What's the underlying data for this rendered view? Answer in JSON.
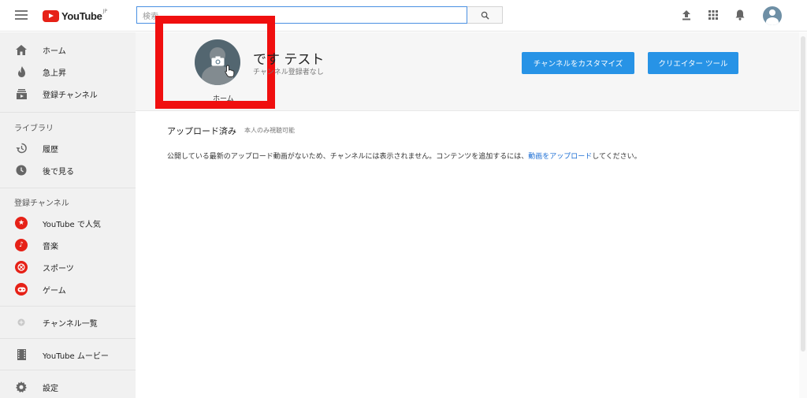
{
  "header": {
    "logo_text": "YouTube",
    "logo_region": "JP",
    "search_placeholder": "検索"
  },
  "sidebar": {
    "primary": [
      {
        "label": "ホーム",
        "icon": "home-icon"
      },
      {
        "label": "急上昇",
        "icon": "flame-icon"
      },
      {
        "label": "登録チャンネル",
        "icon": "subscriptions-icon"
      }
    ],
    "library_heading": "ライブラリ",
    "library": [
      {
        "label": "履歴",
        "icon": "history-icon"
      },
      {
        "label": "後で見る",
        "icon": "clock-icon"
      }
    ],
    "subs_heading": "登録チャンネル",
    "subscriptions": [
      {
        "label": "YouTube で人気",
        "icon": "star-icon"
      },
      {
        "label": "音楽",
        "icon": "music-icon"
      },
      {
        "label": "スポーツ",
        "icon": "sports-icon"
      },
      {
        "label": "ゲーム",
        "icon": "gamepad-icon"
      }
    ],
    "channel_list": "チャンネル一覧",
    "movies": "YouTube ムービー",
    "settings": "設定"
  },
  "channel": {
    "name": "です テスト",
    "subscribers": "チャンネル登録者なし",
    "home_caption": "ホーム",
    "customize_button": "チャンネルをカスタマイズ",
    "studio_button": "クリエイター ツール"
  },
  "content": {
    "section_title": "アップロード済み",
    "section_badge": "本人のみ視聴可能",
    "message_before": "公開している最新のアップロード動画がないため、チャンネルには表示されません。コンテンツを追加するには、",
    "message_link": "動画をアップロード",
    "message_after": "してください。"
  },
  "colors": {
    "brand_red": "#e62117",
    "button_blue": "#2793e6",
    "highlight_box": "#f00f0f",
    "link": "#1c6ed4"
  }
}
